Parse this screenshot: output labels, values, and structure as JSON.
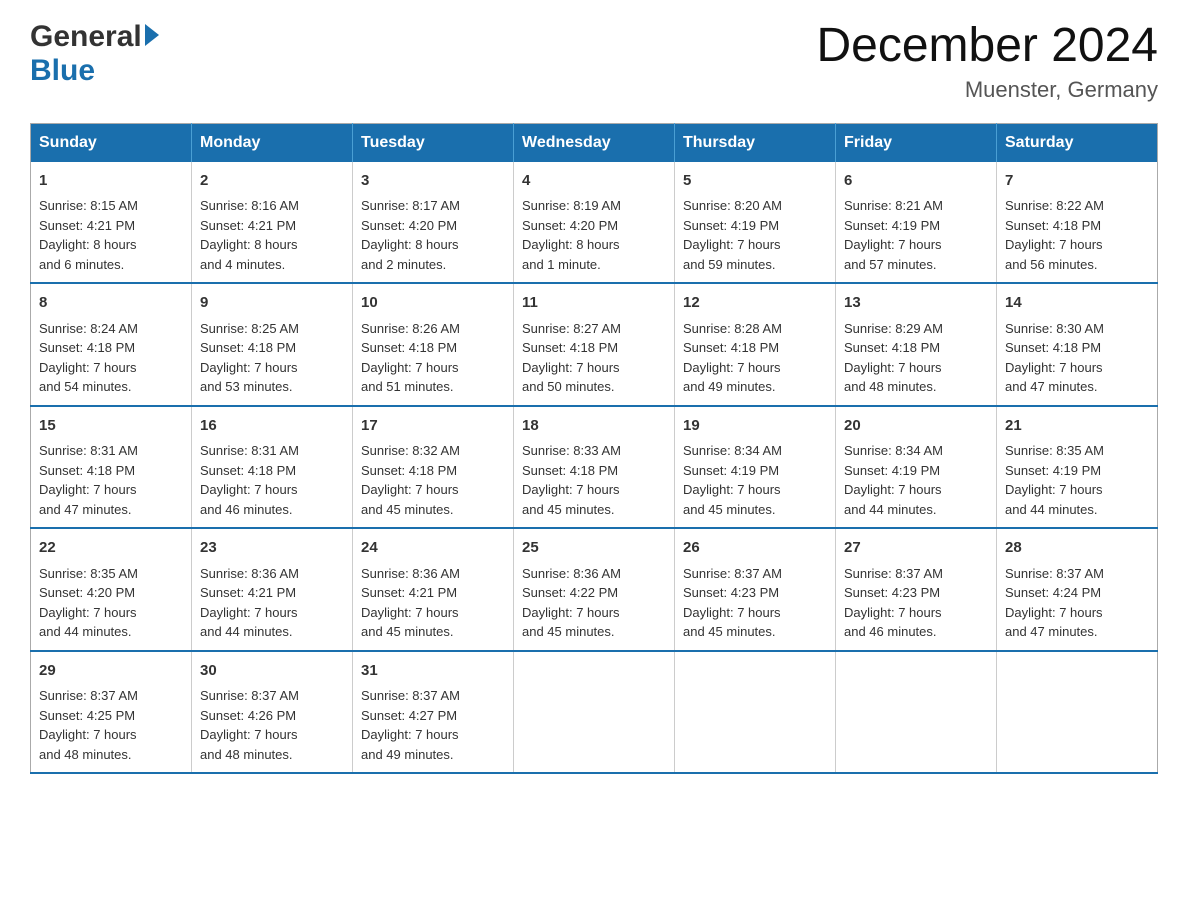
{
  "logo": {
    "general": "General",
    "blue": "Blue"
  },
  "title": "December 2024",
  "location": "Muenster, Germany",
  "days_of_week": [
    "Sunday",
    "Monday",
    "Tuesday",
    "Wednesday",
    "Thursday",
    "Friday",
    "Saturday"
  ],
  "weeks": [
    [
      {
        "day": "1",
        "sunrise": "Sunrise: 8:15 AM",
        "sunset": "Sunset: 4:21 PM",
        "daylight": "Daylight: 8 hours",
        "daylight2": "and 6 minutes."
      },
      {
        "day": "2",
        "sunrise": "Sunrise: 8:16 AM",
        "sunset": "Sunset: 4:21 PM",
        "daylight": "Daylight: 8 hours",
        "daylight2": "and 4 minutes."
      },
      {
        "day": "3",
        "sunrise": "Sunrise: 8:17 AM",
        "sunset": "Sunset: 4:20 PM",
        "daylight": "Daylight: 8 hours",
        "daylight2": "and 2 minutes."
      },
      {
        "day": "4",
        "sunrise": "Sunrise: 8:19 AM",
        "sunset": "Sunset: 4:20 PM",
        "daylight": "Daylight: 8 hours",
        "daylight2": "and 1 minute."
      },
      {
        "day": "5",
        "sunrise": "Sunrise: 8:20 AM",
        "sunset": "Sunset: 4:19 PM",
        "daylight": "Daylight: 7 hours",
        "daylight2": "and 59 minutes."
      },
      {
        "day": "6",
        "sunrise": "Sunrise: 8:21 AM",
        "sunset": "Sunset: 4:19 PM",
        "daylight": "Daylight: 7 hours",
        "daylight2": "and 57 minutes."
      },
      {
        "day": "7",
        "sunrise": "Sunrise: 8:22 AM",
        "sunset": "Sunset: 4:18 PM",
        "daylight": "Daylight: 7 hours",
        "daylight2": "and 56 minutes."
      }
    ],
    [
      {
        "day": "8",
        "sunrise": "Sunrise: 8:24 AM",
        "sunset": "Sunset: 4:18 PM",
        "daylight": "Daylight: 7 hours",
        "daylight2": "and 54 minutes."
      },
      {
        "day": "9",
        "sunrise": "Sunrise: 8:25 AM",
        "sunset": "Sunset: 4:18 PM",
        "daylight": "Daylight: 7 hours",
        "daylight2": "and 53 minutes."
      },
      {
        "day": "10",
        "sunrise": "Sunrise: 8:26 AM",
        "sunset": "Sunset: 4:18 PM",
        "daylight": "Daylight: 7 hours",
        "daylight2": "and 51 minutes."
      },
      {
        "day": "11",
        "sunrise": "Sunrise: 8:27 AM",
        "sunset": "Sunset: 4:18 PM",
        "daylight": "Daylight: 7 hours",
        "daylight2": "and 50 minutes."
      },
      {
        "day": "12",
        "sunrise": "Sunrise: 8:28 AM",
        "sunset": "Sunset: 4:18 PM",
        "daylight": "Daylight: 7 hours",
        "daylight2": "and 49 minutes."
      },
      {
        "day": "13",
        "sunrise": "Sunrise: 8:29 AM",
        "sunset": "Sunset: 4:18 PM",
        "daylight": "Daylight: 7 hours",
        "daylight2": "and 48 minutes."
      },
      {
        "day": "14",
        "sunrise": "Sunrise: 8:30 AM",
        "sunset": "Sunset: 4:18 PM",
        "daylight": "Daylight: 7 hours",
        "daylight2": "and 47 minutes."
      }
    ],
    [
      {
        "day": "15",
        "sunrise": "Sunrise: 8:31 AM",
        "sunset": "Sunset: 4:18 PM",
        "daylight": "Daylight: 7 hours",
        "daylight2": "and 47 minutes."
      },
      {
        "day": "16",
        "sunrise": "Sunrise: 8:31 AM",
        "sunset": "Sunset: 4:18 PM",
        "daylight": "Daylight: 7 hours",
        "daylight2": "and 46 minutes."
      },
      {
        "day": "17",
        "sunrise": "Sunrise: 8:32 AM",
        "sunset": "Sunset: 4:18 PM",
        "daylight": "Daylight: 7 hours",
        "daylight2": "and 45 minutes."
      },
      {
        "day": "18",
        "sunrise": "Sunrise: 8:33 AM",
        "sunset": "Sunset: 4:18 PM",
        "daylight": "Daylight: 7 hours",
        "daylight2": "and 45 minutes."
      },
      {
        "day": "19",
        "sunrise": "Sunrise: 8:34 AM",
        "sunset": "Sunset: 4:19 PM",
        "daylight": "Daylight: 7 hours",
        "daylight2": "and 45 minutes."
      },
      {
        "day": "20",
        "sunrise": "Sunrise: 8:34 AM",
        "sunset": "Sunset: 4:19 PM",
        "daylight": "Daylight: 7 hours",
        "daylight2": "and 44 minutes."
      },
      {
        "day": "21",
        "sunrise": "Sunrise: 8:35 AM",
        "sunset": "Sunset: 4:19 PM",
        "daylight": "Daylight: 7 hours",
        "daylight2": "and 44 minutes."
      }
    ],
    [
      {
        "day": "22",
        "sunrise": "Sunrise: 8:35 AM",
        "sunset": "Sunset: 4:20 PM",
        "daylight": "Daylight: 7 hours",
        "daylight2": "and 44 minutes."
      },
      {
        "day": "23",
        "sunrise": "Sunrise: 8:36 AM",
        "sunset": "Sunset: 4:21 PM",
        "daylight": "Daylight: 7 hours",
        "daylight2": "and 44 minutes."
      },
      {
        "day": "24",
        "sunrise": "Sunrise: 8:36 AM",
        "sunset": "Sunset: 4:21 PM",
        "daylight": "Daylight: 7 hours",
        "daylight2": "and 45 minutes."
      },
      {
        "day": "25",
        "sunrise": "Sunrise: 8:36 AM",
        "sunset": "Sunset: 4:22 PM",
        "daylight": "Daylight: 7 hours",
        "daylight2": "and 45 minutes."
      },
      {
        "day": "26",
        "sunrise": "Sunrise: 8:37 AM",
        "sunset": "Sunset: 4:23 PM",
        "daylight": "Daylight: 7 hours",
        "daylight2": "and 45 minutes."
      },
      {
        "day": "27",
        "sunrise": "Sunrise: 8:37 AM",
        "sunset": "Sunset: 4:23 PM",
        "daylight": "Daylight: 7 hours",
        "daylight2": "and 46 minutes."
      },
      {
        "day": "28",
        "sunrise": "Sunrise: 8:37 AM",
        "sunset": "Sunset: 4:24 PM",
        "daylight": "Daylight: 7 hours",
        "daylight2": "and 47 minutes."
      }
    ],
    [
      {
        "day": "29",
        "sunrise": "Sunrise: 8:37 AM",
        "sunset": "Sunset: 4:25 PM",
        "daylight": "Daylight: 7 hours",
        "daylight2": "and 48 minutes."
      },
      {
        "day": "30",
        "sunrise": "Sunrise: 8:37 AM",
        "sunset": "Sunset: 4:26 PM",
        "daylight": "Daylight: 7 hours",
        "daylight2": "and 48 minutes."
      },
      {
        "day": "31",
        "sunrise": "Sunrise: 8:37 AM",
        "sunset": "Sunset: 4:27 PM",
        "daylight": "Daylight: 7 hours",
        "daylight2": "and 49 minutes."
      },
      {
        "day": "",
        "sunrise": "",
        "sunset": "",
        "daylight": "",
        "daylight2": ""
      },
      {
        "day": "",
        "sunrise": "",
        "sunset": "",
        "daylight": "",
        "daylight2": ""
      },
      {
        "day": "",
        "sunrise": "",
        "sunset": "",
        "daylight": "",
        "daylight2": ""
      },
      {
        "day": "",
        "sunrise": "",
        "sunset": "",
        "daylight": "",
        "daylight2": ""
      }
    ]
  ]
}
